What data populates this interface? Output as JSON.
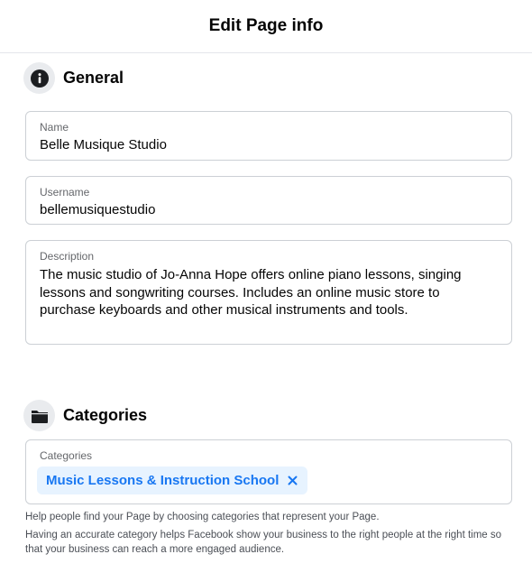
{
  "header": {
    "title": "Edit Page info"
  },
  "general": {
    "title": "General",
    "icon": "info-icon",
    "name": {
      "label": "Name",
      "value": "Belle Musique Studio"
    },
    "username": {
      "label": "Username",
      "value": "bellemusiquestudio"
    },
    "description": {
      "label": "Description",
      "value": "The music studio of Jo-Anna Hope offers online piano lessons, singing lessons and songwriting courses. Includes an online music store to purchase keyboards and other musical instruments and tools."
    }
  },
  "categories": {
    "title": "Categories",
    "icon": "folder-icon",
    "field_label": "Categories",
    "selected": [
      "Music Lessons & Instruction School"
    ],
    "help_1": "Help people find your Page by choosing categories that represent your Page.",
    "help_2": "Having an accurate category helps Facebook show your business to the right people at the right time so that your business can reach a more engaged audience."
  },
  "colors": {
    "accent": "#1877f2",
    "chip_bg": "#e7f3ff",
    "border": "#ccd0d5"
  }
}
